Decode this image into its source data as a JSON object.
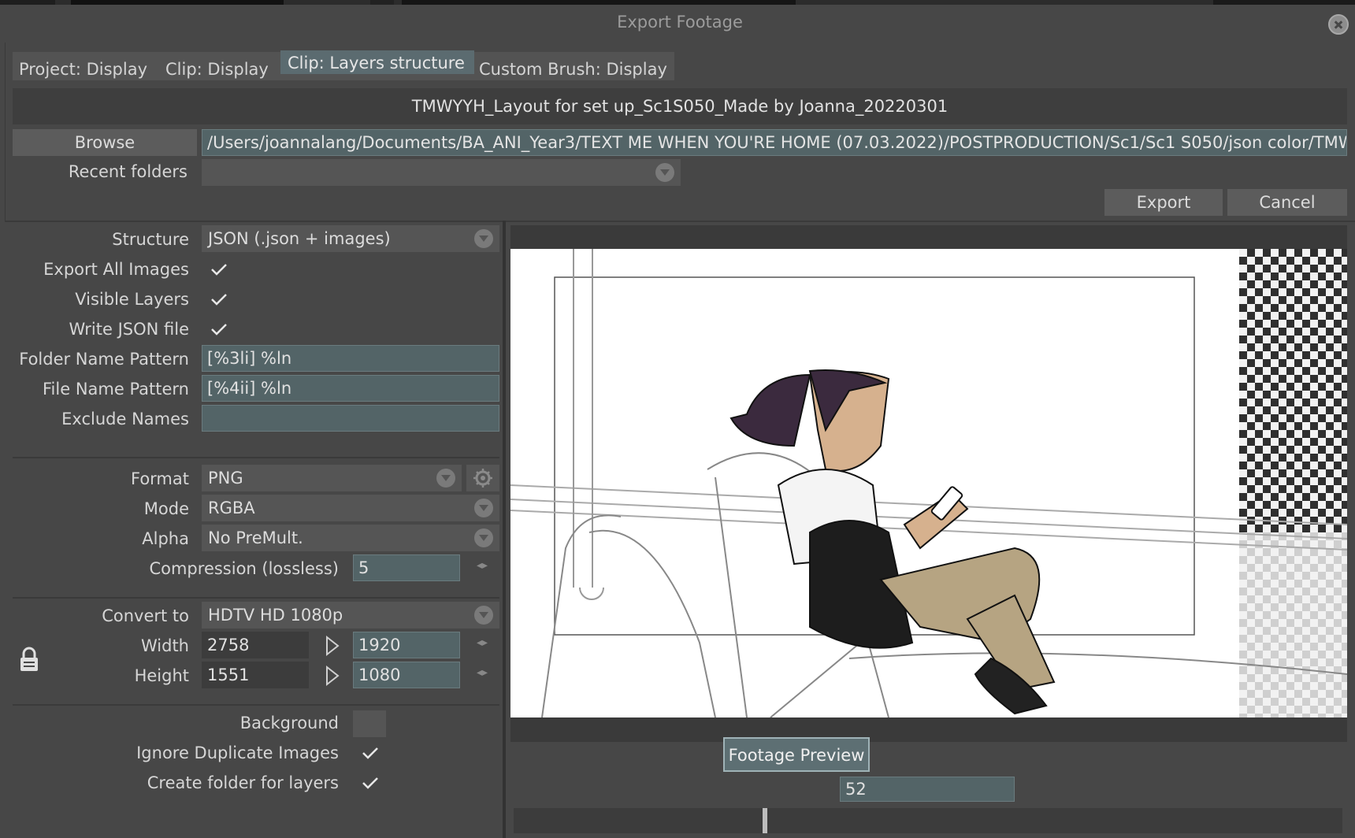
{
  "dialog": {
    "title": "Export Footage"
  },
  "tabs": [
    {
      "label": "Project: Display",
      "active": false
    },
    {
      "label": "Clip: Display",
      "active": false
    },
    {
      "label": "Clip: Layers structure",
      "active": true
    },
    {
      "label": "Custom Brush: Display",
      "active": false
    }
  ],
  "clip_name": "TMWYYH_Layout for set up_Sc1S050_Made by Joanna_20220301",
  "browse": {
    "button_label": "Browse",
    "path": "/Users/joannalang/Documents/BA_ANI_Year3/TEXT ME WHEN YOU'RE HOME (07.03.2022)/POSTPRODUCTION/Sc1/Sc1 S050/json color/TMWY"
  },
  "recent_folders": {
    "label": "Recent folders",
    "value": ""
  },
  "actions": {
    "export_label": "Export",
    "cancel_label": "Cancel"
  },
  "settings": {
    "structure": {
      "label": "Structure",
      "value": "JSON (.json + images)"
    },
    "export_all_images": {
      "label": "Export All Images",
      "checked": true
    },
    "visible_layers": {
      "label": "Visible Layers",
      "checked": true
    },
    "write_json": {
      "label": "Write JSON file",
      "checked": true
    },
    "folder_name_pattern": {
      "label": "Folder Name Pattern",
      "value": "[%3li] %ln"
    },
    "file_name_pattern": {
      "label": "File Name Pattern",
      "value": "[%4ii] %ln"
    },
    "exclude_names": {
      "label": "Exclude Names",
      "value": ""
    },
    "format": {
      "label": "Format",
      "value": "PNG"
    },
    "mode": {
      "label": "Mode",
      "value": "RGBA"
    },
    "alpha": {
      "label": "Alpha",
      "value": "No PreMult."
    },
    "compression": {
      "label": "Compression (lossless)",
      "value": "5"
    },
    "convert_to": {
      "label": "Convert to",
      "value": "HDTV  HD 1080p"
    },
    "width": {
      "label": "Width",
      "source": "2758",
      "target": "1920"
    },
    "height": {
      "label": "Height",
      "source": "1551",
      "target": "1080"
    },
    "background": {
      "label": "Background"
    },
    "ignore_duplicates": {
      "label": "Ignore Duplicate Images",
      "checked": true
    },
    "create_folder": {
      "label": "Create folder for layers",
      "checked": true
    }
  },
  "preview": {
    "button_label": "Footage Preview",
    "frame": "52",
    "slider_position": 0.3
  },
  "colors": {
    "field_teal": "#536467",
    "accent_button": "#5d6f73",
    "panel_bg": "#474747"
  }
}
